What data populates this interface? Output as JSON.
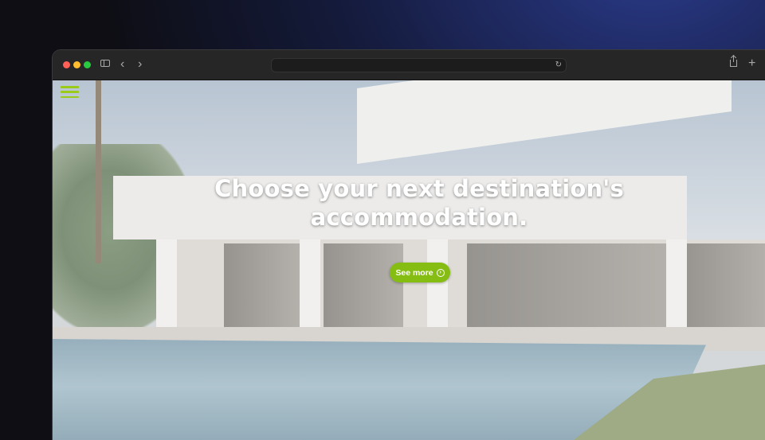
{
  "browser": {
    "address": "",
    "icons": {
      "sidebar": "sidebar-icon",
      "back": "chevron-left-icon",
      "forward": "chevron-right-icon",
      "reload": "reload-icon",
      "share": "share-icon",
      "new_tab": "plus-icon"
    },
    "glyphs": {
      "back": "‹",
      "forward": "›",
      "reload": "↻",
      "new_tab": "+"
    }
  },
  "page": {
    "menu_icon": "hamburger-icon",
    "headline": "Choose your next destination's accommodation.",
    "cta_label": "See more",
    "cta_icon": "circle-arrow-icon",
    "cta_glyph": "›",
    "accent_color": "#86bd12"
  }
}
